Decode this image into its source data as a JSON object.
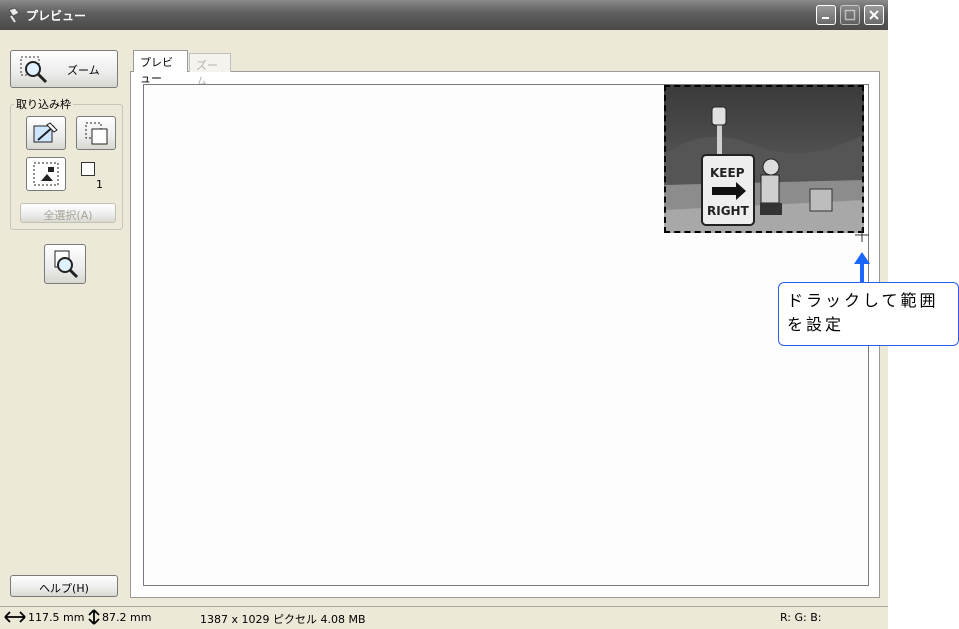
{
  "window": {
    "title": "プレビュー"
  },
  "left_panel": {
    "zoom_button_label": "ズーム",
    "group_label": "取り込み枠",
    "frame_count": "1",
    "select_all_label": "全選択(A)",
    "help_label": "ヘルプ(H)"
  },
  "tabs": [
    {
      "label": "プレビュー",
      "active": true
    },
    {
      "label": "ズーム",
      "active": false
    }
  ],
  "preview": {
    "sign_text_line1": "KEEP",
    "sign_text_line2": "RIGHT"
  },
  "status": {
    "width": "117.5 mm",
    "height": "87.2 mm",
    "info": "1387 x 1029 ピクセル 4.08 MB",
    "rgb": "R: G: B:"
  },
  "callout": {
    "text_line1": "ドラックして範囲",
    "text_line2": "を設定"
  },
  "colors": {
    "callout_border": "#2e5ee8",
    "arrow": "#1a66ff"
  }
}
